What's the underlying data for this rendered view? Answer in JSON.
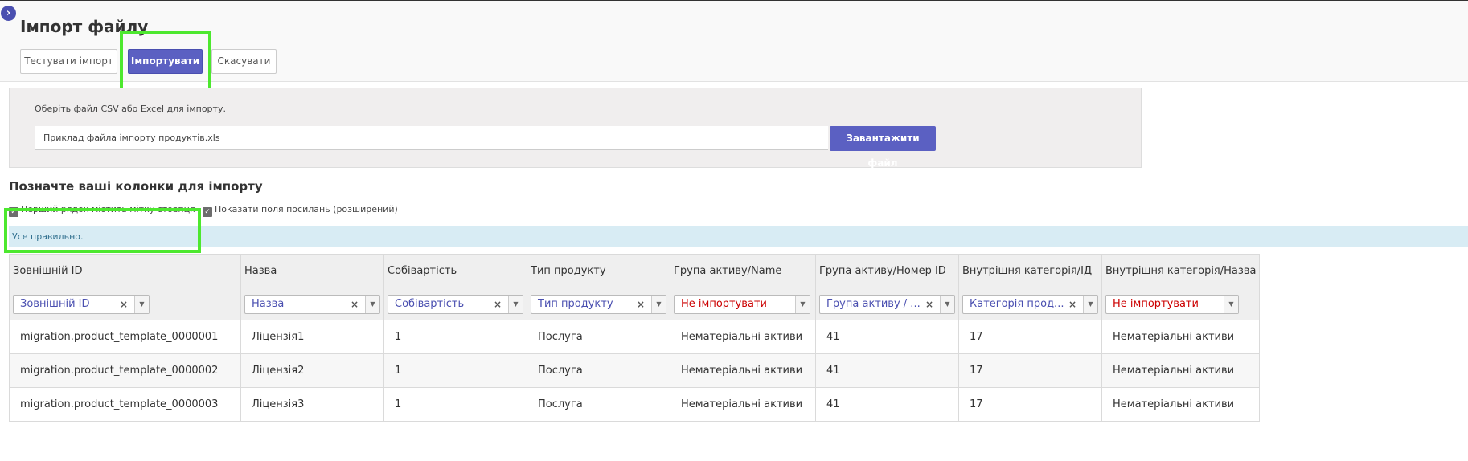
{
  "page": {
    "title": "Імпорт файлу",
    "toggle_icon": "chevron-right-icon"
  },
  "toolbar": {
    "test_label": "Тестувати імпорт",
    "import_label": "Імпортувати",
    "cancel_label": "Скасувати"
  },
  "file": {
    "label": "Оберіть файл CSV або Excel для імпорту.",
    "filename": "Приклад файла імпорту продуктів.xls",
    "upload_label": "Завантажити файл"
  },
  "mapping": {
    "title": "Позначте ваші колонки для імпорту",
    "first_row_label": "Перший рядок містить мітку стовпця",
    "show_fields_label": "Показати поля посилань (розширений)",
    "status": "Усе правильно."
  },
  "table": {
    "headers": [
      "Зовнішній ID",
      "Назва",
      "Собівартість",
      "Тип продукту",
      "Група активу/Name",
      "Група активу/Номер ID",
      "Внутрішня категорія/ІД",
      "Внутрішня категорія/Назва"
    ],
    "selects": [
      {
        "value": "Зовнішній ID",
        "ignored": false
      },
      {
        "value": "Назва",
        "ignored": false
      },
      {
        "value": "Собівартість",
        "ignored": false
      },
      {
        "value": "Тип продукту",
        "ignored": false
      },
      {
        "value": "Не імпортувати",
        "ignored": true
      },
      {
        "value": "Група активу / ...",
        "ignored": false
      },
      {
        "value": "Категорія прод...",
        "ignored": false
      },
      {
        "value": "Не імпортувати",
        "ignored": true
      }
    ],
    "rows": [
      [
        "migration.product_template_0000001",
        "Ліцензія1",
        "1",
        "Послуга",
        "Нематеріальні активи",
        "41",
        "17",
        "Нематеріальні активи"
      ],
      [
        "migration.product_template_0000002",
        "Ліцензія2",
        "1",
        "Послуга",
        "Нематеріальні активи",
        "41",
        "17",
        "Нематеріальні активи"
      ],
      [
        "migration.product_template_0000003",
        "Ліцензія3",
        "1",
        "Послуга",
        "Нематеріальні активи",
        "41",
        "17",
        "Нематеріальні активи"
      ]
    ]
  },
  "colors": {
    "accent": "#5b60c2",
    "highlight": "#4de82f",
    "alert_bg": "#d8ecf4",
    "ignored_text": "#cc0000"
  }
}
